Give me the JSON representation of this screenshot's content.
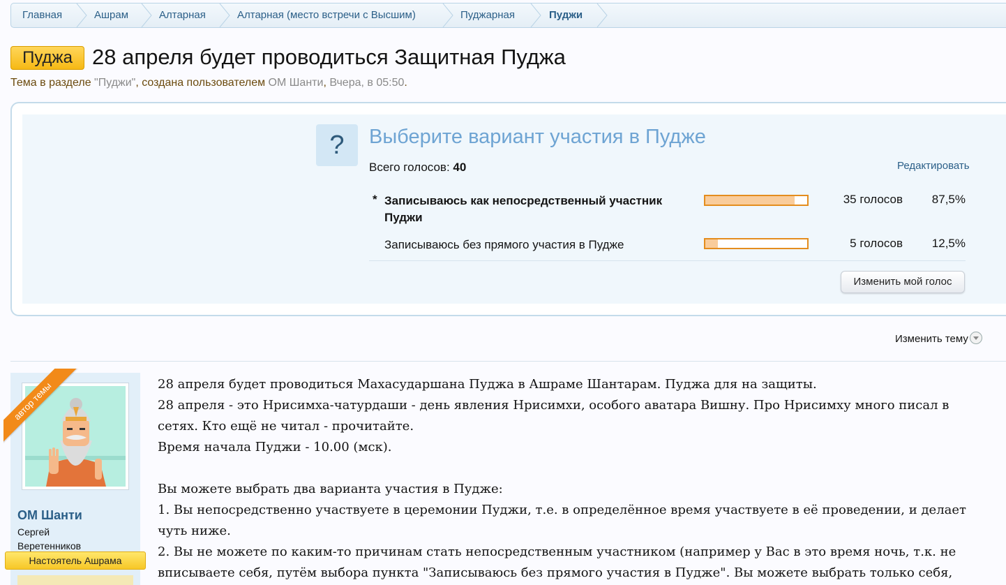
{
  "breadcrumb": [
    "Главная",
    "Ашрам",
    "Алтарная",
    "Алтарная (место встречи с Высшим)",
    "Пуджарная",
    "Пуджи"
  ],
  "thread": {
    "prefix": "Пуджа",
    "title": "28 апреля будет проводиться Защитная Пуджа",
    "meta": {
      "text1": "Тема в разделе ",
      "section": "\"Пуджи\"",
      "text2": ", создана пользователем ",
      "author": "ОМ Шанти",
      "text3": ", ",
      "time": "Вчера, в 05:50",
      "text4": "."
    }
  },
  "poll": {
    "question": "Выберите вариант участия в Пудже",
    "total_label": "Всего голосов:",
    "total": "40",
    "edit_label": "Редактировать",
    "options": [
      {
        "star": "*",
        "label_line1": "Записываюсь как непосредственный участник",
        "label_line2": "Пуджи",
        "votes": "35 голосов",
        "percent": "87,5%",
        "fraction": 0.875
      },
      {
        "star": "",
        "label_line1": "Записываюсь без прямого участия в Пудже",
        "label_line2": "",
        "votes": "5 голосов",
        "percent": "12,5%",
        "fraction": 0.125
      }
    ],
    "change_vote_label": "Изменить мой голос"
  },
  "change_topic_label": "Изменить тему",
  "user": {
    "ribbon": "автор темы",
    "name": "ОМ Шанти",
    "real_name_1": "Сергей",
    "real_name_2": "Веретенников",
    "rank": "Настоятель Ашрама"
  },
  "message": {
    "lines": [
      "28 апреля будет проводиться Махасударшана Пуджа в Ашраме Шантарам. Пуджа для на защиты.",
      "28 апреля - это Нрисимха-чатурдаши - день явления Нрисимхи, особого аватара Вишну. Про Нрисимху много писал в",
      "сетях. Кто ещё не читал - прочитайте.",
      "Время начала Пуджи - 10.00 (мск).",
      "",
      "Вы можете выбрать два варианта участия в Пудже:",
      "1. Вы непосредственно участвуете в церемонии Пуджи, т.е. в определённое время участвуете в её проведении, и делает",
      "чуть ниже.",
      "2. Вы не можете по каким-то причинам стать непосредственным участником (например у Вас в это время ночь, т.к. не",
      "вписываете себя, путём выбора пункта \"Записываюсь без прямого участия в Пудже\". Вы можете выбрать только себя,"
    ]
  },
  "colors": {
    "link": "#2b5f88",
    "poll_question": "#6ea4d3",
    "bar_border": "#e48d1e",
    "bar_fill": "#f9cc9b",
    "prefix_bg": "#f6b915",
    "ribbon": "#f28a19"
  }
}
